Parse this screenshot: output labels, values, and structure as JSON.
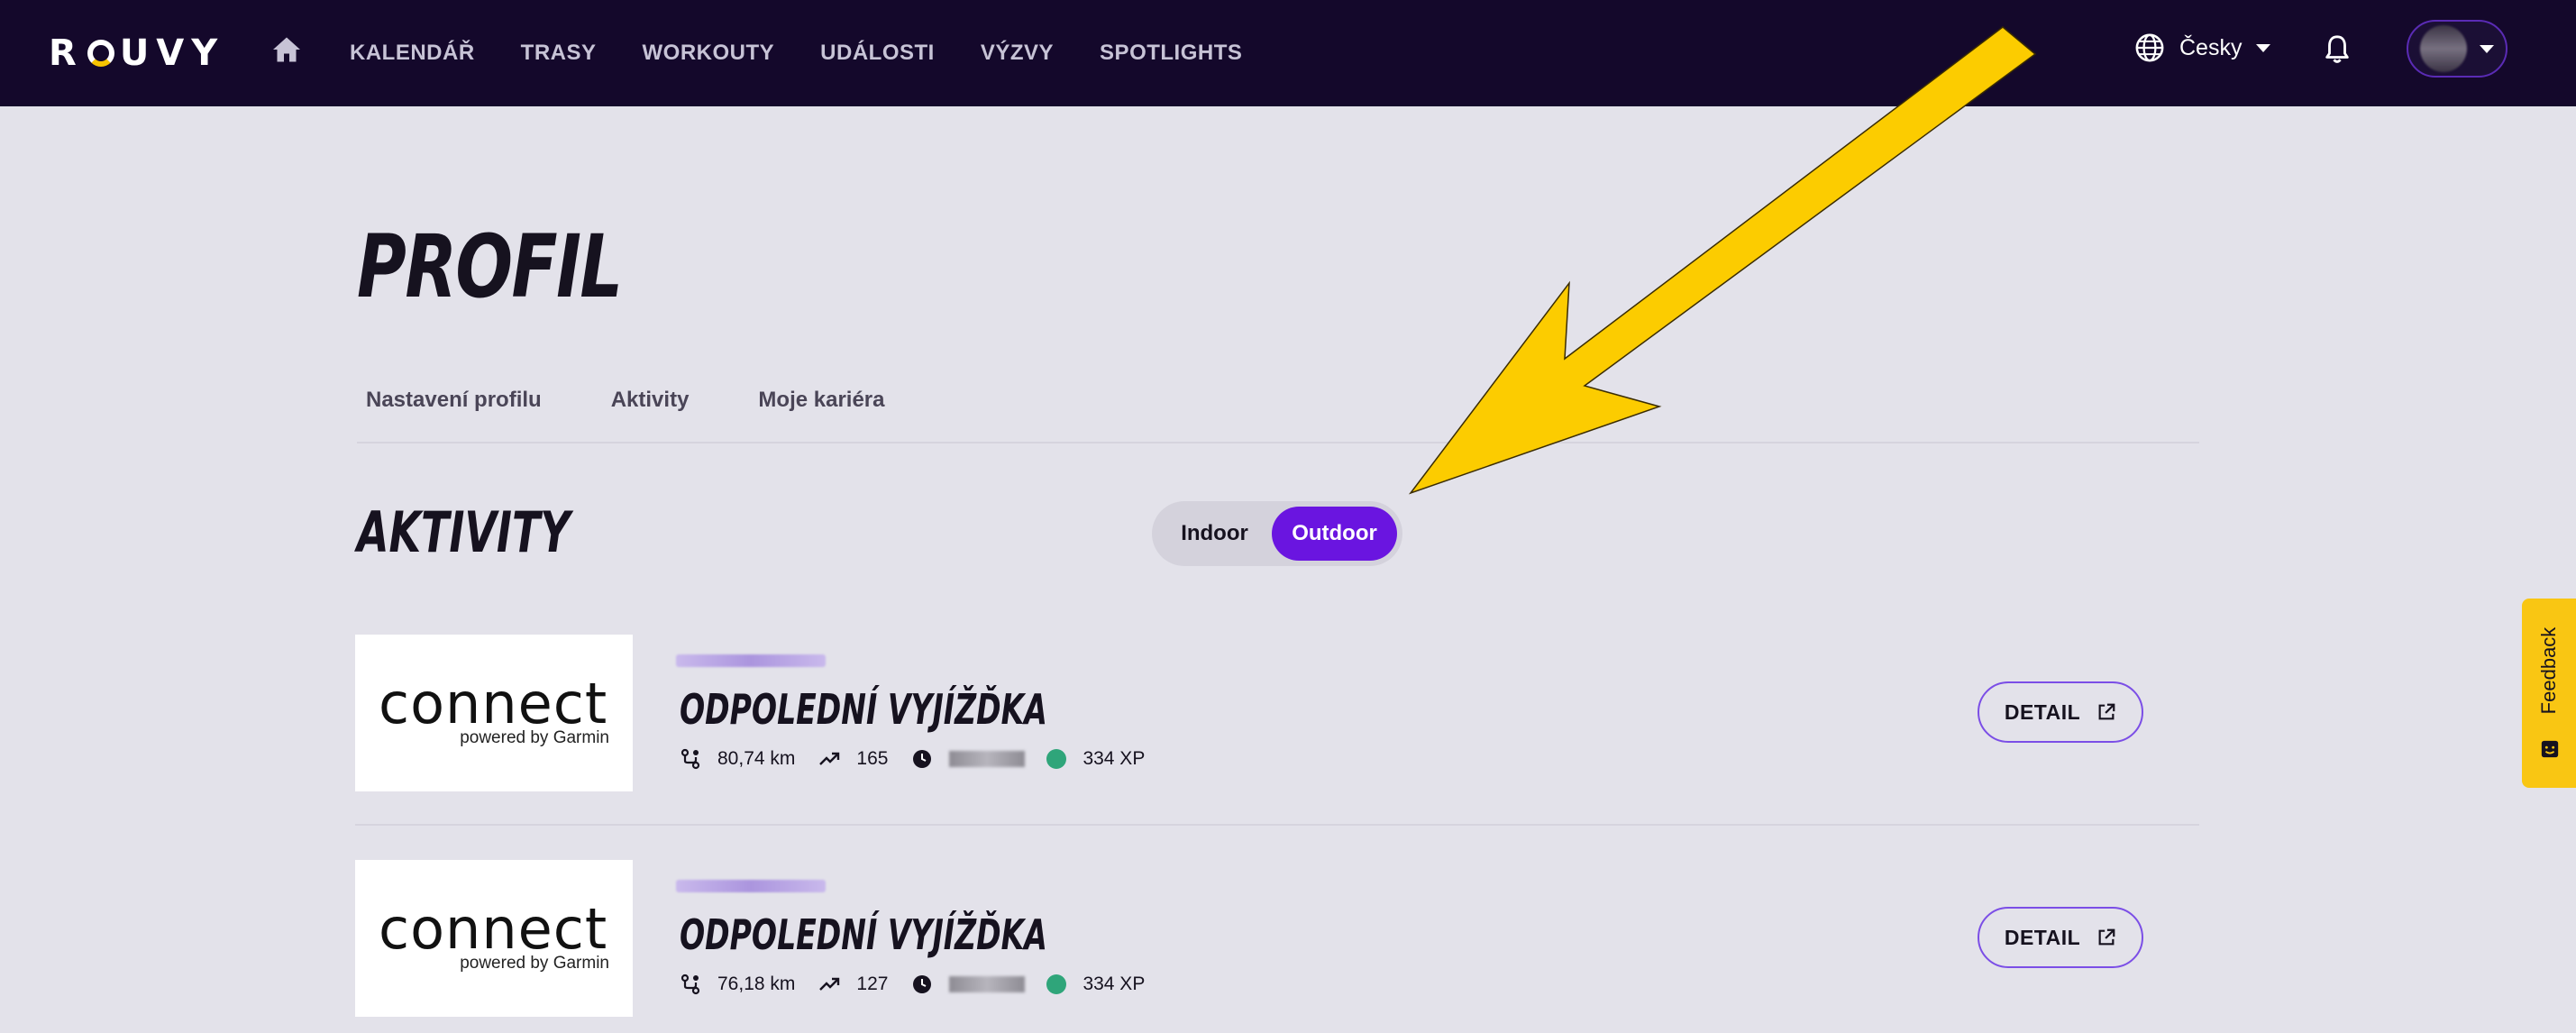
{
  "header": {
    "logo_text": "ROUVY",
    "nav": [
      "KALENDÁŘ",
      "TRASY",
      "WORKOUTY",
      "UDÁLOSTI",
      "VÝZVY",
      "SPOTLIGHTS"
    ],
    "language": "Česky"
  },
  "page": {
    "title": "PROFIL",
    "tabs": [
      "Nastavení profilu",
      "Aktivity",
      "Moje kariéra"
    ],
    "section_title": "AKTIVITY",
    "toggle": {
      "indoor": "Indoor",
      "outdoor": "Outdoor",
      "selected": "Outdoor"
    }
  },
  "activities": [
    {
      "source_brand": "connect",
      "source_sub": "powered by Garmin",
      "name": "ODPOLEDNÍ VYJÍŽĎKA",
      "distance": "80,74 km",
      "elevation": "165",
      "xp": "334 XP",
      "detail_label": "DETAIL"
    },
    {
      "source_brand": "connect",
      "source_sub": "powered by Garmin",
      "name": "ODPOLEDNÍ VYJÍŽĎKA",
      "distance": "76,18 km",
      "elevation": "127",
      "xp": "334 XP",
      "detail_label": "DETAIL"
    }
  ],
  "feedback": {
    "label": "Feedback"
  },
  "colors": {
    "header_bg": "#14082b",
    "page_bg": "#e3e2ea",
    "accent_purple": "#6a15e0",
    "feedback_yellow": "#f9c613",
    "arrow_yellow": "#fccc00"
  },
  "icons": {
    "home": "home-icon",
    "language": "globe-icon",
    "notifications": "bell-icon",
    "distance": "route-icon",
    "elevation": "trend-up-icon",
    "time": "clock-icon",
    "xp": "xp-badge-icon",
    "detail": "external-link-icon"
  }
}
